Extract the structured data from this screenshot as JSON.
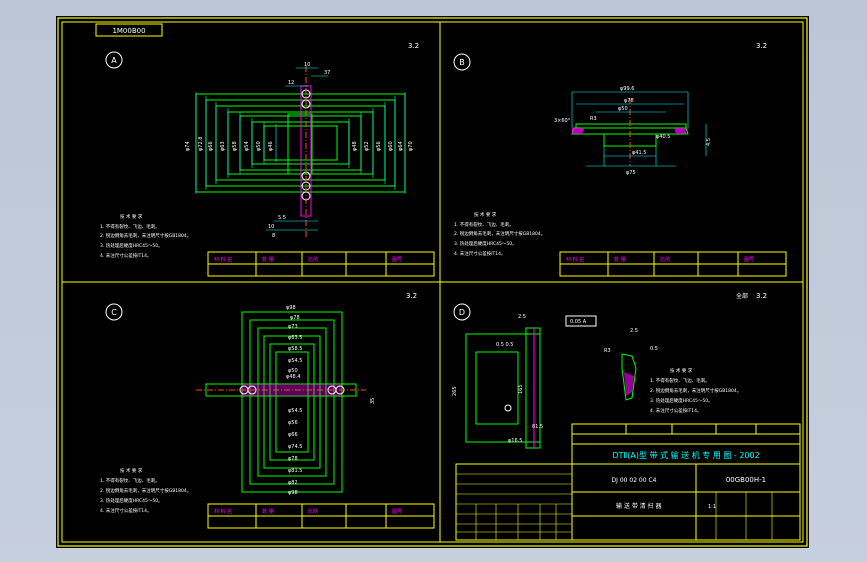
{
  "drawing_number_box": "1M00B00",
  "views": {
    "a": {
      "label": "A",
      "roughness": "3.2"
    },
    "b": {
      "label": "B",
      "roughness": "3.2"
    },
    "c": {
      "label": "C",
      "roughness": "3.2"
    },
    "d": {
      "label": "D",
      "roughness": "3.2",
      "roughness_note": "全部"
    }
  },
  "notes": {
    "title": "技 术 要 求",
    "lines": [
      "1. 不得有裂纹、飞边、毛刺。",
      "2. 锐边倒角去毛刺，未注明尺寸按GB1804。",
      "3. 热处理后硬度HRC45～50。",
      "4. 未注尺寸公差按IT14。"
    ]
  },
  "mini_table": {
    "c1": "材 料 名",
    "c2": "数 量",
    "c3": "比例",
    "c4": "图号"
  },
  "title_block": {
    "project": "DTⅡ(A)型  带 式 输 送 机 专 用 图 - 2002",
    "drawing_no": "00GB00H-1",
    "series_no": "DJ 00 02 00 C4",
    "part_name": "输 送 带 清 扫 器",
    "scale": "1:1"
  },
  "colors": {
    "frame": "#ffff00",
    "geometry": "#00ff00",
    "dims": "#00ffff",
    "text": "#ffffff",
    "hatch": "#ff00ff"
  }
}
